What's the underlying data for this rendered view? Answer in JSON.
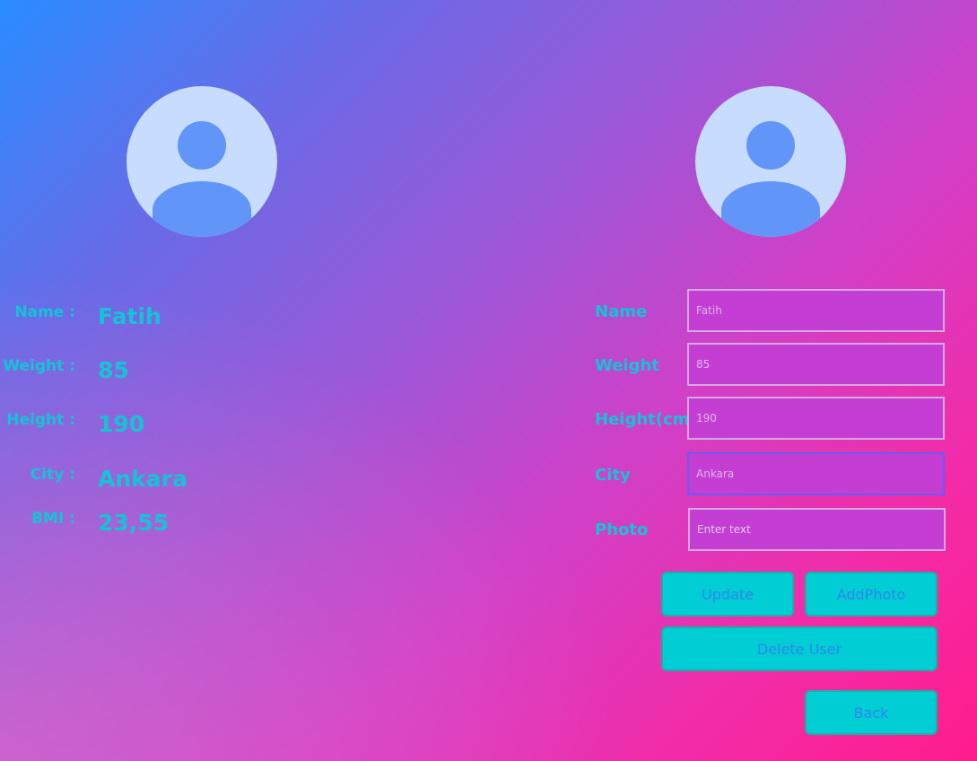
{
  "profile": {
    "avatar_icon": "user-avatar-icon",
    "fields": [
      {
        "label": "Name :",
        "value": "Fatih"
      },
      {
        "label": "Weight :",
        "value": "85"
      },
      {
        "label": "Height :",
        "value": "190"
      },
      {
        "label": "City :",
        "value": "Ankara"
      },
      {
        "label": "BMI :",
        "value": "23,55"
      }
    ]
  },
  "edit_form": {
    "avatar_icon": "user-avatar-icon",
    "name": {
      "label": "Name",
      "value": "Fatih"
    },
    "weight": {
      "label": "Weight",
      "value": "85"
    },
    "height": {
      "label": "Height(cm)",
      "value": "190"
    },
    "city": {
      "label": "City",
      "value": "Ankara"
    },
    "photo": {
      "label": "Photo",
      "placeholder": "Enter text"
    }
  },
  "buttons": {
    "update": "Update",
    "add_photo": "AddPhoto",
    "delete_user": "Delete User",
    "back": "Back"
  },
  "colors": {
    "accent_text": "#14c3d6",
    "button_bg": "#00cdd4",
    "button_text": "#2f86f0",
    "field_bg": "#c43ed4"
  }
}
